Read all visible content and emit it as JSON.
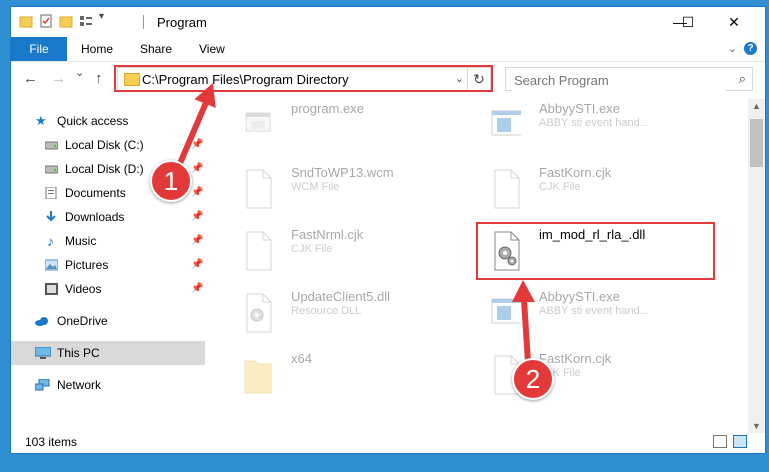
{
  "window": {
    "title": "Program",
    "controls": {
      "minimize": "—",
      "maximize": "☐",
      "close": "✕"
    }
  },
  "ribbon": {
    "tabs": [
      {
        "label": "File"
      },
      {
        "label": "Home"
      },
      {
        "label": "Share"
      },
      {
        "label": "View"
      }
    ],
    "help": "?"
  },
  "navigation": {
    "back": "←",
    "forward": "→",
    "recent": "⌄",
    "up": "↑",
    "address": "C:\\Program Files\\Program Directory",
    "refresh": "↻",
    "search_placeholder": "Search Program"
  },
  "sidebar": {
    "items": [
      {
        "label": "Quick access",
        "icon": "star-icon"
      },
      {
        "label": "Local Disk (C:)",
        "icon": "drive-icon",
        "pinned": true
      },
      {
        "label": "Local Disk (D:)",
        "icon": "drive-icon",
        "pinned": true
      },
      {
        "label": "Documents",
        "icon": "documents-icon",
        "pinned": true
      },
      {
        "label": "Downloads",
        "icon": "download-icon",
        "pinned": true
      },
      {
        "label": "Music",
        "icon": "music-icon",
        "pinned": true
      },
      {
        "label": "Pictures",
        "icon": "pictures-icon",
        "pinned": true
      },
      {
        "label": "Videos",
        "icon": "videos-icon",
        "pinned": true
      },
      {
        "label": "OneDrive",
        "icon": "cloud-icon"
      },
      {
        "label": "This PC",
        "icon": "computer-icon",
        "selected": true
      },
      {
        "label": "Network",
        "icon": "network-icon"
      }
    ]
  },
  "files": [
    {
      "name": "program.exe",
      "type": "",
      "icon": "exe-icon"
    },
    {
      "name": "AbbyySTI.exe",
      "type": "ABBY sti event hand...",
      "icon": "window-app-icon"
    },
    {
      "name": "SndToWP13.wcm",
      "type": "WCM File",
      "icon": "blank-file-icon"
    },
    {
      "name": "FastKorn.cjk",
      "type": "CJK File",
      "icon": "blank-file-icon"
    },
    {
      "name": "FastNrml.cjk",
      "type": "CJK File",
      "icon": "blank-file-icon"
    },
    {
      "name": "im_mod_rl_rla_.dll",
      "type": "",
      "icon": "dll-gear-icon"
    },
    {
      "name": "UpdateClient5.dll",
      "type": "Resource DLL",
      "icon": "dll-gear-icon"
    },
    {
      "name": "AbbyySTI.exe",
      "type": "ABBY sti event hand...",
      "icon": "window-app-icon"
    },
    {
      "name": "x64",
      "type": "",
      "icon": "folder-icon"
    },
    {
      "name": "FastKorn.cjk",
      "type": "CJK File",
      "icon": "blank-file-icon"
    }
  ],
  "status": {
    "count": "103 items"
  },
  "callouts": [
    "1",
    "2"
  ],
  "colors": {
    "accent": "#1979ca",
    "highlight": "#e23a3a",
    "desktop": "#2f8fd1"
  }
}
